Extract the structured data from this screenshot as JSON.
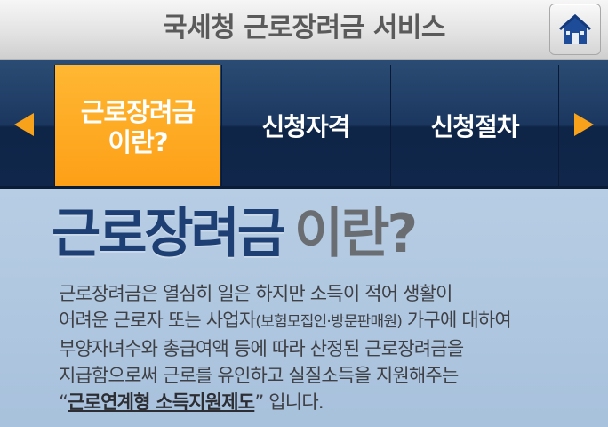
{
  "header": {
    "title": "국세청 근로장려금 서비스",
    "home_icon": "home-icon"
  },
  "tabs": [
    {
      "label": "근로장려금\n이란?",
      "active": true
    },
    {
      "label": "신청자격",
      "active": false
    },
    {
      "label": "신청절차",
      "active": false
    }
  ],
  "content": {
    "headline_main": "근로장려금",
    "headline_sub": "이란?",
    "lines": {
      "l1": "근로장려금은 열심히 일은 하지만 소득이 적어 생활이",
      "l2a": "어려운 근로자 또는 사업자",
      "l2b": "(보험모집인·방문판매원)",
      "l2c": " 가구에 대하여",
      "l3": "부양자녀수와 총급여액 등에 따라 산정된 근로장려금을",
      "l4": "지급함으로써  근로를 유인하고 실질소득을 지원해주는",
      "l5a": "“",
      "l5b": "근로연계형 소득지원제도",
      "l5c": "” 입니다."
    }
  },
  "colors": {
    "accent": "#f7a21a",
    "nav": "#1b3760",
    "headline": "#1e3f73"
  }
}
